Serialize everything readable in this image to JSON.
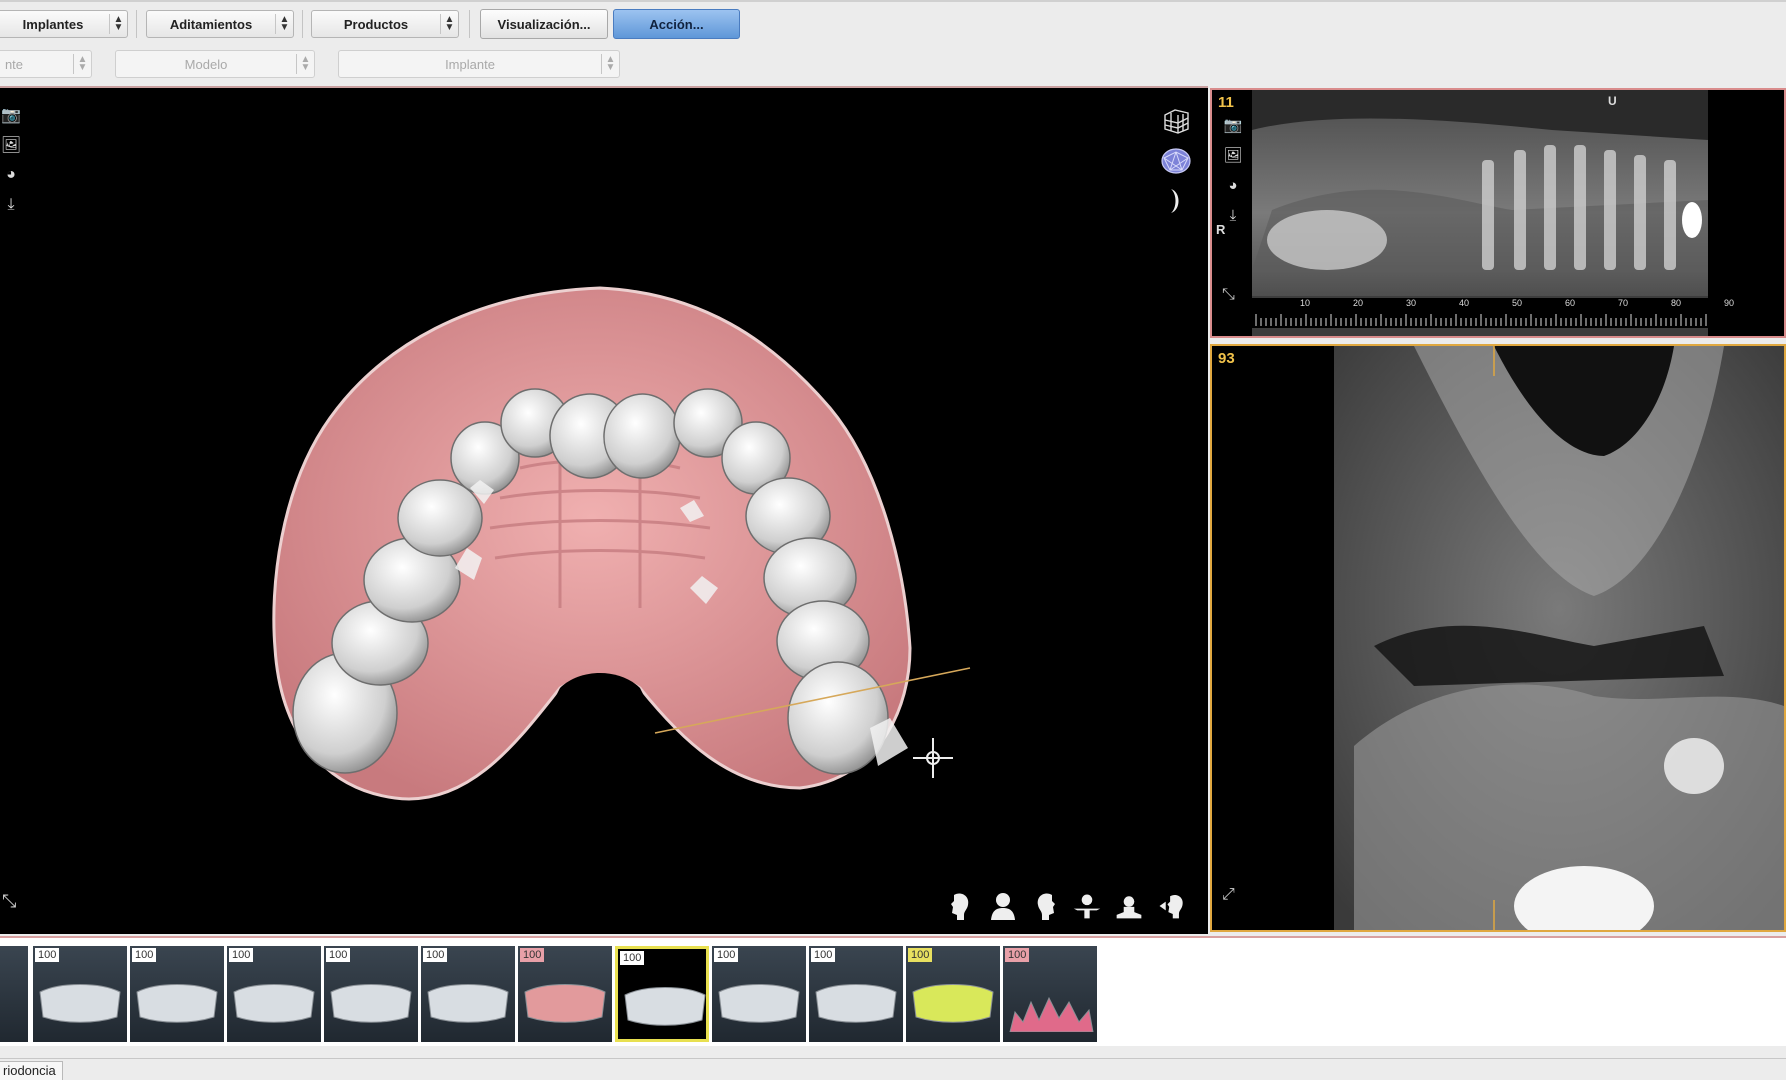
{
  "toolbar": {
    "implantes": "Implantes",
    "aditamientos": "Aditamientos",
    "productos": "Productos",
    "visualizacion": "Visualización...",
    "accion": "Acción..."
  },
  "subbar": {
    "field1": "nte",
    "modelo": "Modelo",
    "implante": "Implante"
  },
  "panes": {
    "panoramic_number": "11",
    "panoramic_orientation_r": "R",
    "panoramic_orientation_u": "U",
    "panoramic_ruler_ticks": [
      "10",
      "20",
      "30",
      "40",
      "50",
      "60",
      "70",
      "80",
      "90"
    ],
    "cross_section_number": "93"
  },
  "thumbs": [
    {
      "badge": "100",
      "color": "#ffffff"
    },
    {
      "badge": "100",
      "color": "#ffffff"
    },
    {
      "badge": "100",
      "color": "#ffffff"
    },
    {
      "badge": "100",
      "color": "#ffffff"
    },
    {
      "badge": "100",
      "color": "#ffffff"
    },
    {
      "badge": "100",
      "color": "#e8a0a8"
    },
    {
      "badge": "100",
      "color": "#ffffff"
    },
    {
      "badge": "100",
      "color": "#ffffff"
    },
    {
      "badge": "100",
      "color": "#ffffff"
    },
    {
      "badge": "100",
      "color": "#e8e060"
    },
    {
      "badge": "100",
      "color": "#e8a0a8"
    }
  ],
  "status": {
    "tab_label": "riodoncia"
  },
  "colors": {
    "accent": "#5f97d8",
    "pano_border": "#d98c8c",
    "xsec_border": "#e0a840",
    "gum": "#e29a9c",
    "selected_thumb": "#e8e050"
  }
}
